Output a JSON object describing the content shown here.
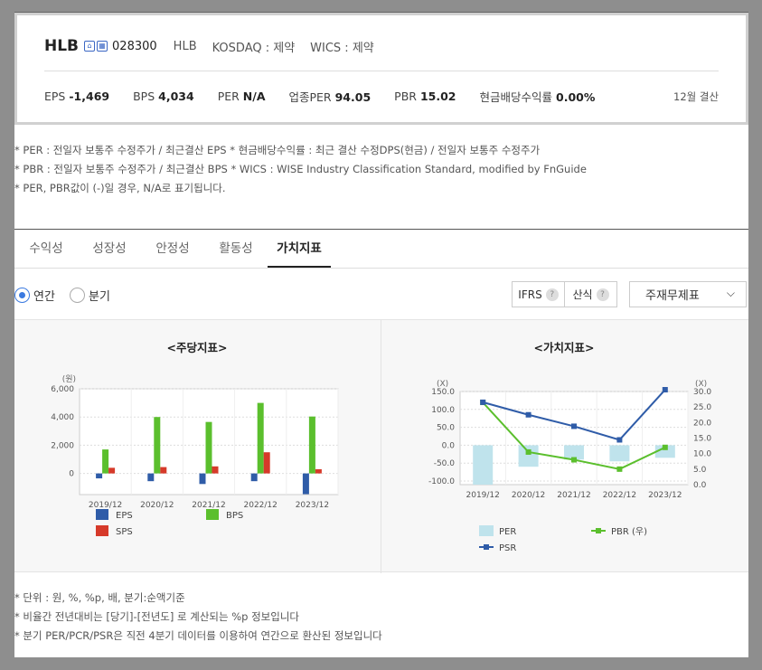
{
  "summary": {
    "name": "HLB",
    "icon_a": "home-icon",
    "icon_b": "building-icon",
    "code": "028300",
    "eng": "HLB",
    "market": "KOSDAQ : 제약",
    "wics": "WICS : 제약",
    "metrics": [
      {
        "label": "EPS",
        "value": "-1,469"
      },
      {
        "label": "BPS",
        "value": "4,034"
      },
      {
        "label": "PER",
        "value": "N/A"
      },
      {
        "label": "업종PER",
        "value": "94.05"
      },
      {
        "label": "PBR",
        "value": "15.02"
      },
      {
        "label": "현금배당수익률",
        "value": "0.00%"
      }
    ],
    "closing": "12월 결산"
  },
  "notes": [
    "* PER : 전일자 보통주 수정주가 / 최근결산 EPS * 현금배당수익률 : 최근 결산 수정DPS(현금) / 전일자 보통주 수정주가",
    "* PBR : 전일자 보통주 수정주가 / 최근결산 BPS * WICS : WISE Industry Classification Standard, modified by FnGuide",
    "* PER, PBR값이 (-)일 경우, N/A로 표기됩니다."
  ],
  "tabs": [
    "수익성",
    "성장성",
    "안정성",
    "활동성",
    "가치지표"
  ],
  "active_tab": 4,
  "controls": {
    "annual": "연간",
    "quarter": "분기",
    "ifrs": "IFRS",
    "calc": "산식",
    "help": "?",
    "select": "주재무제표"
  },
  "chart_data": [
    {
      "type": "bar",
      "title": "<주당지표>",
      "ylabel": "(원)",
      "categories": [
        "2019/12",
        "2020/12",
        "2021/12",
        "2022/12",
        "2023/12"
      ],
      "yticks": [
        "6,000",
        "4,000",
        "2,000",
        "0"
      ],
      "ylim": [
        -1500,
        6000
      ],
      "series": [
        {
          "name": "EPS",
          "color": "#2f5ca8",
          "values": [
            -350,
            -550,
            -750,
            -550,
            -1469
          ]
        },
        {
          "name": "BPS",
          "color": "#5bbf2d",
          "values": [
            1700,
            4000,
            3650,
            5000,
            4034
          ]
        },
        {
          "name": "SPS",
          "color": "#d63a2a",
          "values": [
            400,
            450,
            500,
            1500,
            300
          ]
        }
      ],
      "legend": "bottom"
    },
    {
      "type": "bar+line",
      "title": "<가치지표>",
      "ylabel_left": "(X)",
      "ylabel_right": "(X)",
      "categories": [
        "2019/12",
        "2020/12",
        "2021/12",
        "2022/12",
        "2023/12"
      ],
      "yticks_left": [
        "150.0",
        "100.0",
        "50.0",
        "0.0",
        "-50.0",
        "-100.0"
      ],
      "yticks_right": [
        "30.0",
        "25.0",
        "20.0",
        "15.0",
        "10.0",
        "5.0",
        "0.0"
      ],
      "ylim_left": [
        -110,
        150
      ],
      "ylim_right": [
        0,
        30
      ],
      "series": [
        {
          "name": "PER",
          "kind": "bar",
          "axis": "left",
          "color": "#bfe3ec",
          "values": [
            -110,
            -60,
            -40,
            -45,
            -35
          ]
        },
        {
          "name": "PBR (우)",
          "kind": "line",
          "axis": "right",
          "color": "#5bbf2d",
          "values": [
            26.5,
            10.5,
            8.0,
            5.0,
            12.0
          ]
        },
        {
          "name": "PSR",
          "kind": "line",
          "axis": "left",
          "color": "#2f5ca8",
          "values": [
            120,
            85,
            53,
            15,
            155
          ]
        }
      ],
      "legend": "bottom"
    }
  ],
  "footnotes": [
    "* 단위 : 원, %, %p, 배, 분기:순액기준",
    "* 비율간 전년대비는 [당기]-[전년도] 로 계산되는 %p 정보입니다",
    "* 분기 PER/PCR/PSR은 직전 4분기 데이터를 이용하여 연간으로 환산된 정보입니다"
  ]
}
